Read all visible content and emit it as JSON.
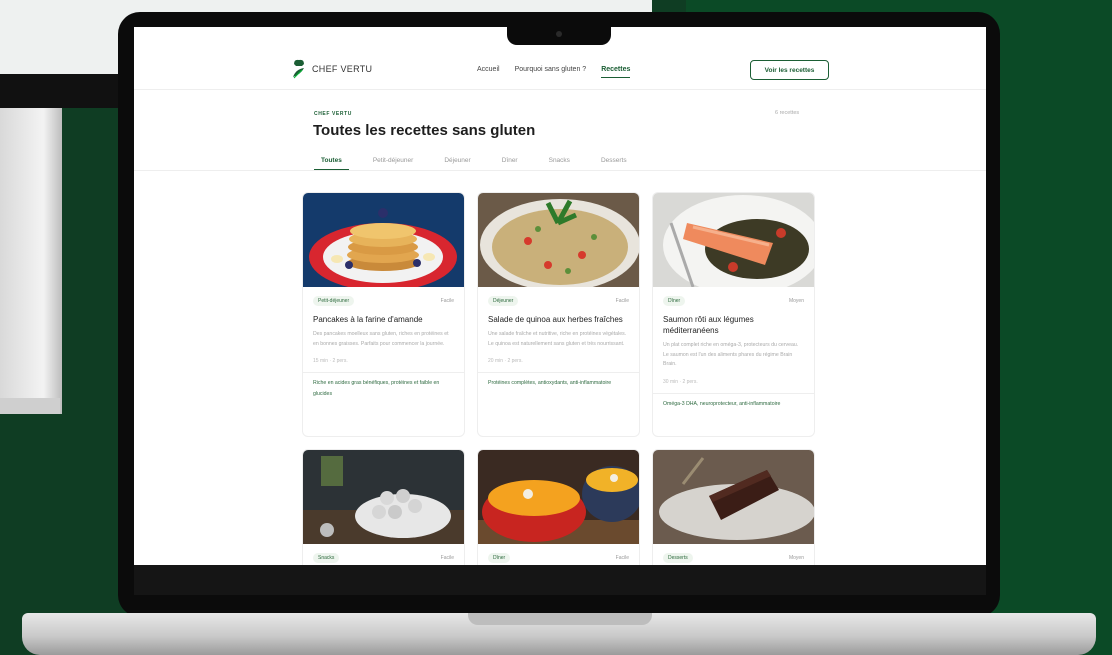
{
  "brand": {
    "name": "CHEF VERTU"
  },
  "nav": {
    "links": [
      "Accueil",
      "Pourquoi sans gluten ?",
      "Recettes"
    ],
    "active": "Recettes",
    "cta": "Voir les recettes"
  },
  "page": {
    "kicker": "CHEF VERTU",
    "title": "Toutes les recettes sans gluten",
    "count": "6 recettes"
  },
  "tabs": [
    "Toutes",
    "Petit-déjeuner",
    "Déjeuner",
    "Dîner",
    "Snacks",
    "Desserts"
  ],
  "recipes": [
    {
      "category": "Petit-déjeuner",
      "difficulty": "Facile",
      "title": "Pancakes à la farine d'amande",
      "description": "Des pancakes moelleux sans gluten, riches en protéines et en bonnes graisses. Parfaits pour commencer la journée.",
      "time": "15 min · 2 pers.",
      "benefit": "Riche en acides gras bénéfiques, protéines et faible en glucides"
    },
    {
      "category": "Déjeuner",
      "difficulty": "Facile",
      "title": "Salade de quinoa aux herbes fraîches",
      "description": "Une salade fraîche et nutritive, riche en protéines végétales. Le quinoa est naturellement sans gluten et très nourrissant.",
      "time": "20 min · 2 pers.",
      "benefit": "Protéines complètes, antioxydants, anti-inflammatoire"
    },
    {
      "category": "Dîner",
      "difficulty": "Moyen",
      "title": "Saumon rôti aux légumes méditerranéens",
      "description": "Un plat complet riche en oméga-3, protecteurs du cerveau. Le saumon est l'un des aliments phares du régime Brain Brain.",
      "time": "30 min · 2 pers.",
      "benefit": "Oméga-3 DHA, neuroprotecteur, anti-inflammatoire"
    },
    {
      "category": "Snacks",
      "difficulty": "Facile"
    },
    {
      "category": "Dîner",
      "difficulty": "Facile"
    },
    {
      "category": "Desserts",
      "difficulty": "Moyen"
    }
  ],
  "colors": {
    "accent": "#1b5e34",
    "background_green": "#0b4a26",
    "badge_bg": "#eef5ee"
  }
}
